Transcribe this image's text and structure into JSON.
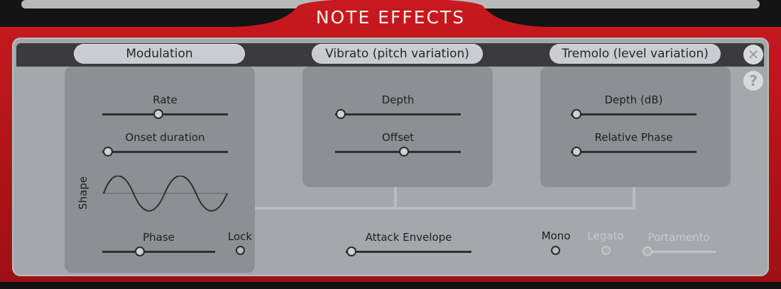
{
  "title": "NOTE EFFECTS",
  "sections": {
    "modulation": "Modulation",
    "vibrato": "Vibrato (pitch variation)",
    "tremolo": "Tremolo (level variation)"
  },
  "modulation": {
    "rate_label": "Rate",
    "rate_value": 0.4,
    "onset_label": "Onset duration",
    "onset_value": 0,
    "shape_label": "Shape",
    "phase_label": "Phase",
    "phase_value": 0.28,
    "lock_label": "Lock"
  },
  "vibrato": {
    "depth_label": "Depth",
    "depth_value": 0,
    "offset_label": "Offset",
    "offset_value": 0.5
  },
  "tremolo": {
    "depth_label": "Depth (dB)",
    "depth_value": 0,
    "phase_label": "Relative Phase",
    "phase_value": 0
  },
  "attack": {
    "label": "Attack Envelope",
    "value": 0
  },
  "voice": {
    "mono_label": "Mono",
    "legato_label": "Legato",
    "portamento_label": "Portamento",
    "portamento_value": 0
  },
  "icons": {
    "close": "close-icon",
    "help": "help-icon"
  },
  "colors": {
    "frame_red": "#b4141a",
    "panel": "#a4a8ad",
    "box": "#8c9094",
    "header": "#3b3b3e"
  }
}
